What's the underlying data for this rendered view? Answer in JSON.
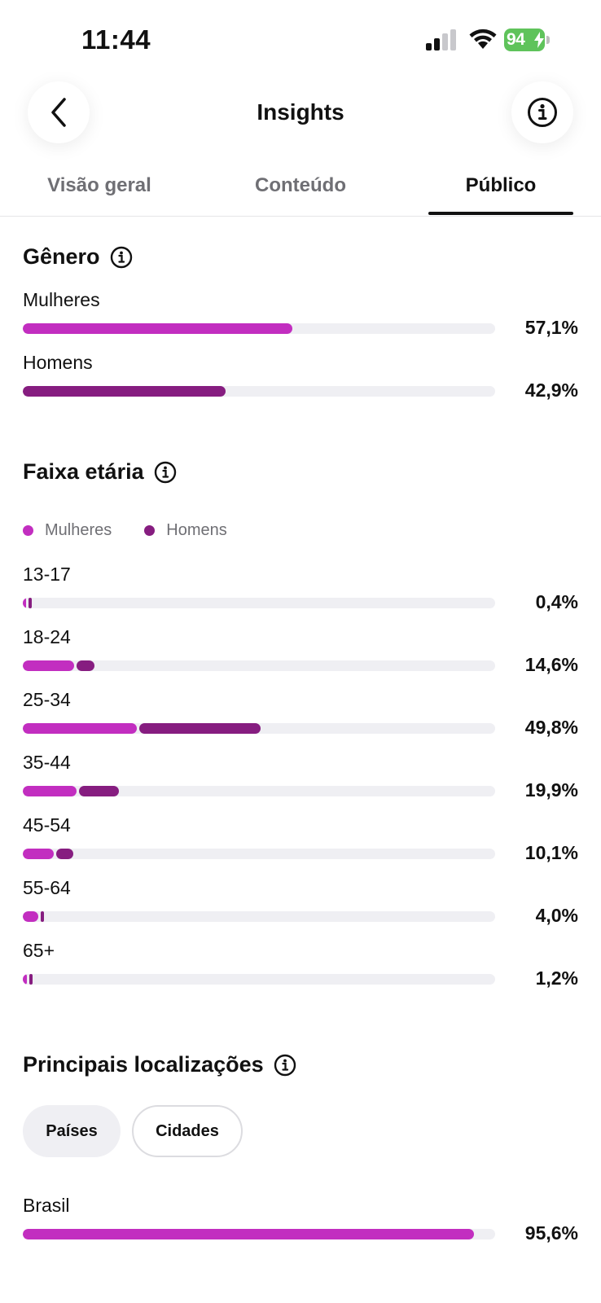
{
  "status_bar": {
    "time": "11:44",
    "battery": "94",
    "battery_color": "#5fc35b"
  },
  "header": {
    "title": "Insights",
    "back_icon": "chevron-left-icon",
    "info_icon": "info-icon"
  },
  "tabs": [
    {
      "label": "Visão geral",
      "active": false
    },
    {
      "label": "Conteúdo",
      "active": false
    },
    {
      "label": "Público",
      "active": true
    }
  ],
  "gender": {
    "title": "Gênero",
    "rows": [
      {
        "label": "Mulheres",
        "value": 57.1,
        "display": "57,1%",
        "color": "#c22ec0"
      },
      {
        "label": "Homens",
        "value": 42.9,
        "display": "42,9%",
        "color": "#861d80"
      }
    ]
  },
  "age": {
    "title": "Faixa etária",
    "legend": [
      {
        "label": "Mulheres",
        "color": "#c22ec0"
      },
      {
        "label": "Homens",
        "color": "#861d80"
      }
    ],
    "rows": [
      {
        "label": "13-17",
        "display": "0,4%",
        "women": 0.3,
        "men": 0.1
      },
      {
        "label": "18-24",
        "display": "14,6%",
        "women": 10.9,
        "men": 3.7
      },
      {
        "label": "25-34",
        "display": "49,8%",
        "women": 24.2,
        "men": 25.6
      },
      {
        "label": "35-44",
        "display": "19,9%",
        "women": 11.3,
        "men": 8.6
      },
      {
        "label": "45-54",
        "display": "10,1%",
        "women": 6.5,
        "men": 3.6
      },
      {
        "label": "55-64",
        "display": "4,0%",
        "women": 3.2,
        "men": 0.8
      },
      {
        "label": "65+",
        "display": "1,2%",
        "women": 0.8,
        "men": 0.4
      }
    ]
  },
  "locations": {
    "title": "Principais localizações",
    "chips": [
      {
        "label": "Países",
        "selected": true
      },
      {
        "label": "Cidades",
        "selected": false
      }
    ],
    "rows": [
      {
        "label": "Brasil",
        "value": 95.6,
        "display": "95,6%",
        "color": "#c22ec0"
      }
    ]
  }
}
